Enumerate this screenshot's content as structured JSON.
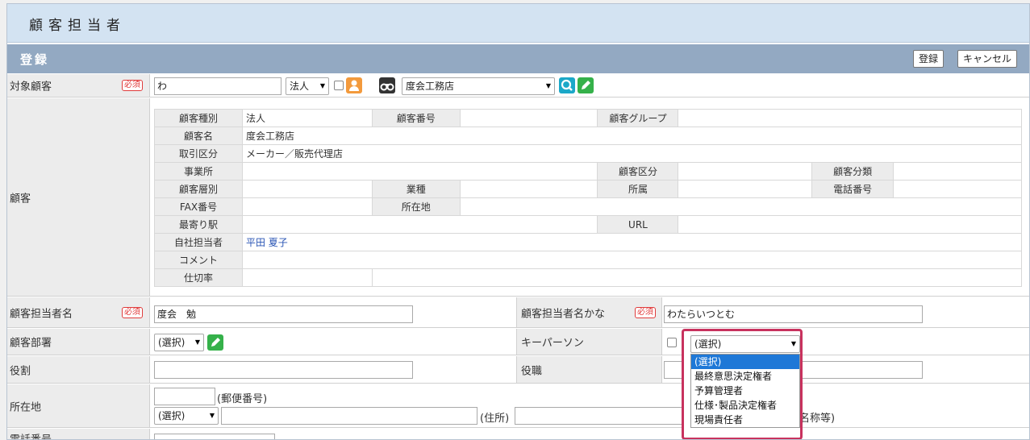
{
  "header": {
    "title": "顧客担当者"
  },
  "section": {
    "title": "登録",
    "register_label": "登録",
    "cancel_label": "キャンセル"
  },
  "required_badge": "必須",
  "target_customer": {
    "label": "対象顧客",
    "search_value": "わ",
    "type_select": "法人",
    "customer_select": "度会工務店"
  },
  "customer": {
    "label": "顧客",
    "rows": [
      {
        "h1": "顧客種別",
        "v1": "法人",
        "h2": "顧客番号",
        "v2": "",
        "h3": "顧客グループ",
        "v3": ""
      },
      {
        "h1": "顧客名",
        "v1": "度会工務店"
      },
      {
        "h1": "取引区分",
        "v1": "メーカー／販売代理店"
      },
      {
        "h1": "事業所",
        "v1": "",
        "h3": "顧客区分",
        "v3": "",
        "h4": "顧客分類",
        "v4": ""
      },
      {
        "h1": "顧客層別",
        "v1": "",
        "h2": "業種",
        "v2": "",
        "h3": "所属",
        "v3": "",
        "h4": "電話番号",
        "v4": ""
      },
      {
        "h1": "FAX番号",
        "v1": "",
        "h2": "所在地",
        "v2": ""
      },
      {
        "h1": "最寄り駅",
        "v1": "",
        "h3": "URL",
        "v3": ""
      },
      {
        "h1": "自社担当者",
        "v1": "平田 夏子"
      },
      {
        "h1": "コメント",
        "v1": ""
      },
      {
        "h1": "仕切率",
        "v1": ""
      }
    ]
  },
  "contact_name": {
    "label": "顧客担当者名",
    "value": "度会　勉",
    "kana_label": "顧客担当者名かな",
    "kana_value": "わたらいつとむ"
  },
  "department": {
    "label": "顧客部署",
    "select": "(選択)",
    "keyperson_label": "キーパーソン"
  },
  "role": {
    "label": "役割",
    "title_label": "役職"
  },
  "address": {
    "label": "所在地",
    "postal_suffix": "(郵便番号)",
    "prefecture_select": "(選択)",
    "address_suffix": "(住所)",
    "building_suffix": "名称等)"
  },
  "phone": {
    "label": "電話番号"
  },
  "keyperson_dropdown": {
    "selected": "(選択)",
    "options": [
      "(選択)",
      "最終意思決定権者",
      "予算管理者",
      "仕様･製品決定権者",
      "現場責任者"
    ]
  },
  "colors": {
    "header_bg": "#d3e3f2",
    "section_bg": "#93a9c2",
    "highlight_border": "#c8325e",
    "selection_blue": "#1e78d7"
  }
}
